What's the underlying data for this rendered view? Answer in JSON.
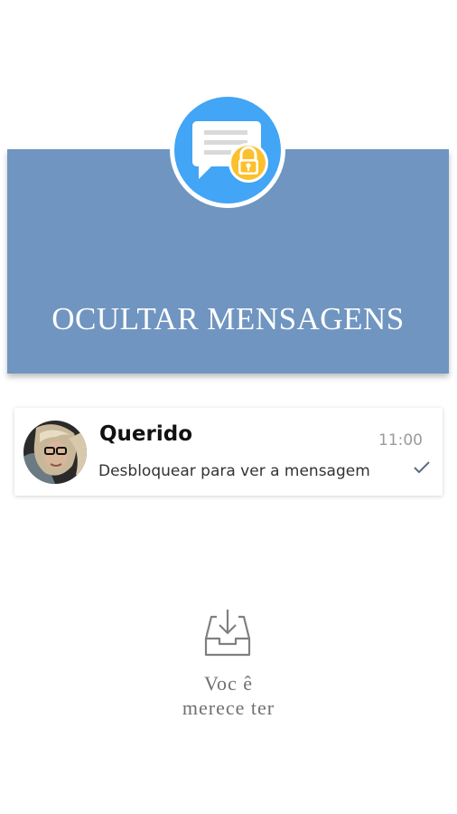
{
  "hero": {
    "title": "OCULTAR MENSAGENS",
    "background_color": "#7095c0",
    "icon": "chat-lock-icon"
  },
  "message_card": {
    "contact_name": "Querido",
    "time": "11:00",
    "preview": "Desbloquear para ver a mensagem",
    "status_icon": "check-icon",
    "avatar": "avatar"
  },
  "empty_state": {
    "icon": "inbox-download-icon",
    "line1": "Voc ê",
    "line2": "merece ter"
  },
  "colors": {
    "accent_blue": "#42a5f5",
    "lock_yellow": "#fbc02d"
  }
}
